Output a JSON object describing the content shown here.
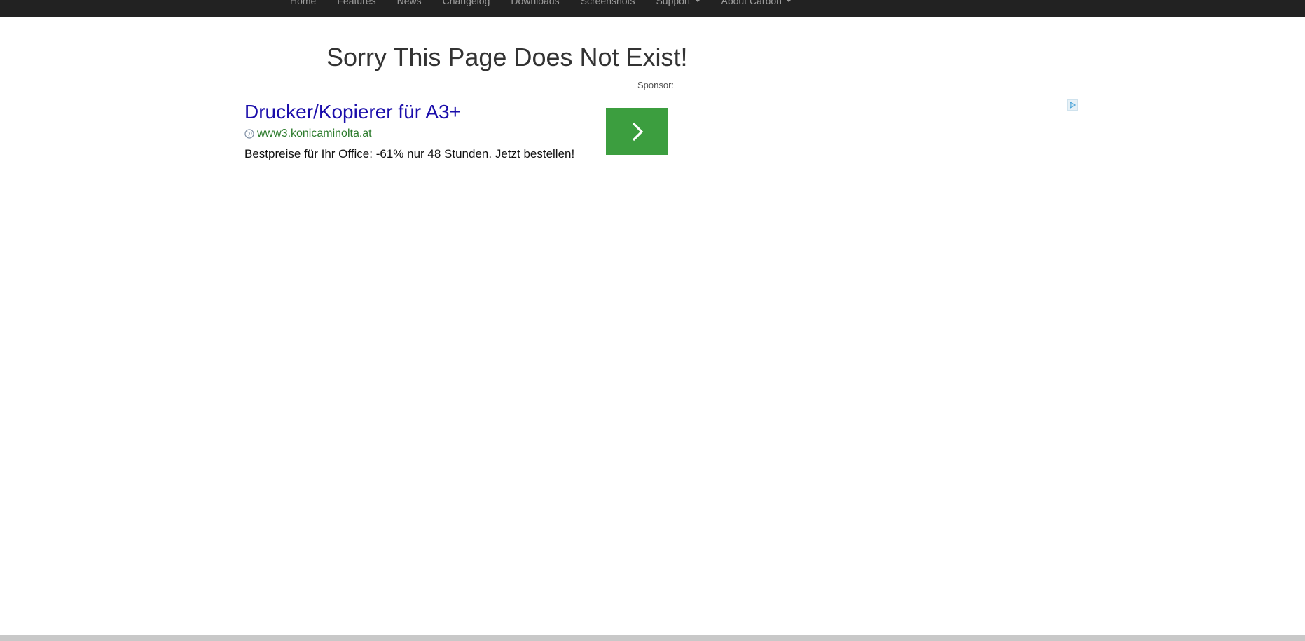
{
  "nav": {
    "items": [
      {
        "label": "Home",
        "dropdown": false
      },
      {
        "label": "Features",
        "dropdown": false
      },
      {
        "label": "News",
        "dropdown": false
      },
      {
        "label": "Changelog",
        "dropdown": false
      },
      {
        "label": "Downloads",
        "dropdown": false
      },
      {
        "label": "Screenshots",
        "dropdown": false
      },
      {
        "label": "Support",
        "dropdown": true
      },
      {
        "label": "About Carbon",
        "dropdown": true
      }
    ]
  },
  "main": {
    "headline": "Sorry This Page Does Not Exist!"
  },
  "sponsor": {
    "label": "Sponsor:"
  },
  "ad": {
    "title": "Drucker/Kopierer für A3+",
    "url": "www3.konicaminolta.at",
    "description": "Bestpreise für Ihr Office: -61% nur 48 Stunden. Jetzt bestellen!",
    "icons": {
      "url_icon": "globe-icon",
      "arrow": "chevron-right-icon",
      "adchoices": "adchoices-icon"
    }
  },
  "colors": {
    "nav_background": "#222222",
    "nav_text": "#9d9d9d",
    "ad_title": "#1a0dab",
    "ad_url": "#2a7a2a",
    "ad_button": "#3c9e3f",
    "footer": "#c8c8c8"
  }
}
